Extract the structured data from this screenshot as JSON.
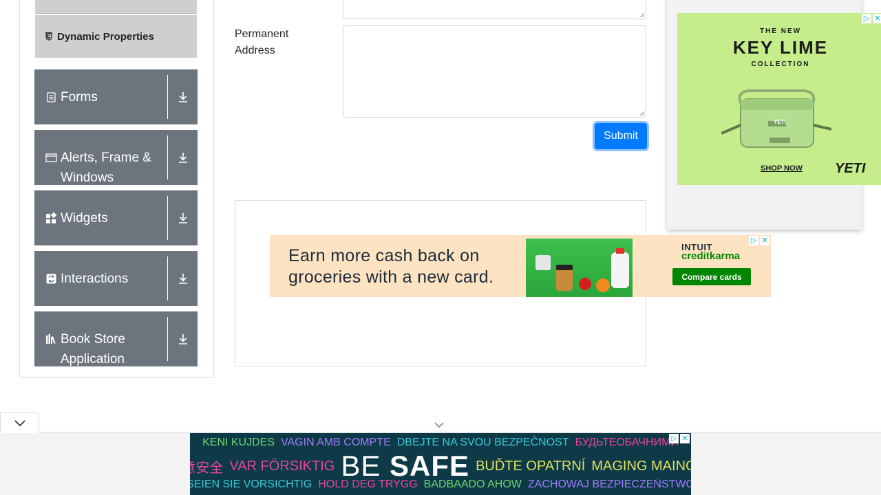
{
  "sidebar": {
    "active_item": {
      "label": "Dynamic Properties",
      "icon": "html5-icon"
    },
    "groups": [
      {
        "label": "Forms",
        "icon": "document-icon"
      },
      {
        "label": "Alerts, Frame & Windows",
        "icon": "window-icon"
      },
      {
        "label": "Widgets",
        "icon": "widgets-icon"
      },
      {
        "label": "Interactions",
        "icon": "interactions-icon"
      },
      {
        "label": "Book Store Application",
        "icon": "books-icon"
      }
    ]
  },
  "form": {
    "permanent_address_label": "Permanent Address",
    "submit_label": "Submit"
  },
  "ads": {
    "creditkarma": {
      "headline": "Earn more cash back on groceries with a new card.",
      "logo_top": "INTUIT",
      "logo_bottom": "creditkarma",
      "cta": "Compare cards"
    },
    "yeti": {
      "line1": "THE NEW",
      "line2": "KEY LIME",
      "line3": "COLLECTION",
      "product_label": "YETI",
      "shop": "SHOP NOW",
      "brand": "YETI"
    },
    "be_safe": {
      "row1": [
        "KENI KUJDES",
        "VAGIN AMB COMPTE",
        "DBEJTE NA SVOU BEZPEČNOST",
        "БУДЬТЕОБАЧНИМИ"
      ],
      "row2_left": [
        "注意安全",
        "VAR FÖRSIKTIG"
      ],
      "big_be": "BE",
      "big_safe": "SAFE",
      "row2_right": [
        "BUĎTE OPATRNÍ",
        "MAGING MAINGAT"
      ],
      "row3": [
        "SEIEN SIE VORSICHTIG",
        "HOLD DEG TRYGG",
        "BADBAADO AHOW",
        "ZACHOWAJ BEZPIECZEŃSTWO"
      ]
    }
  },
  "colors": {
    "sidebar_group_bg": "#6c757d",
    "sidebar_active_bg": "#cfcfcf",
    "primary": "#007bff"
  }
}
